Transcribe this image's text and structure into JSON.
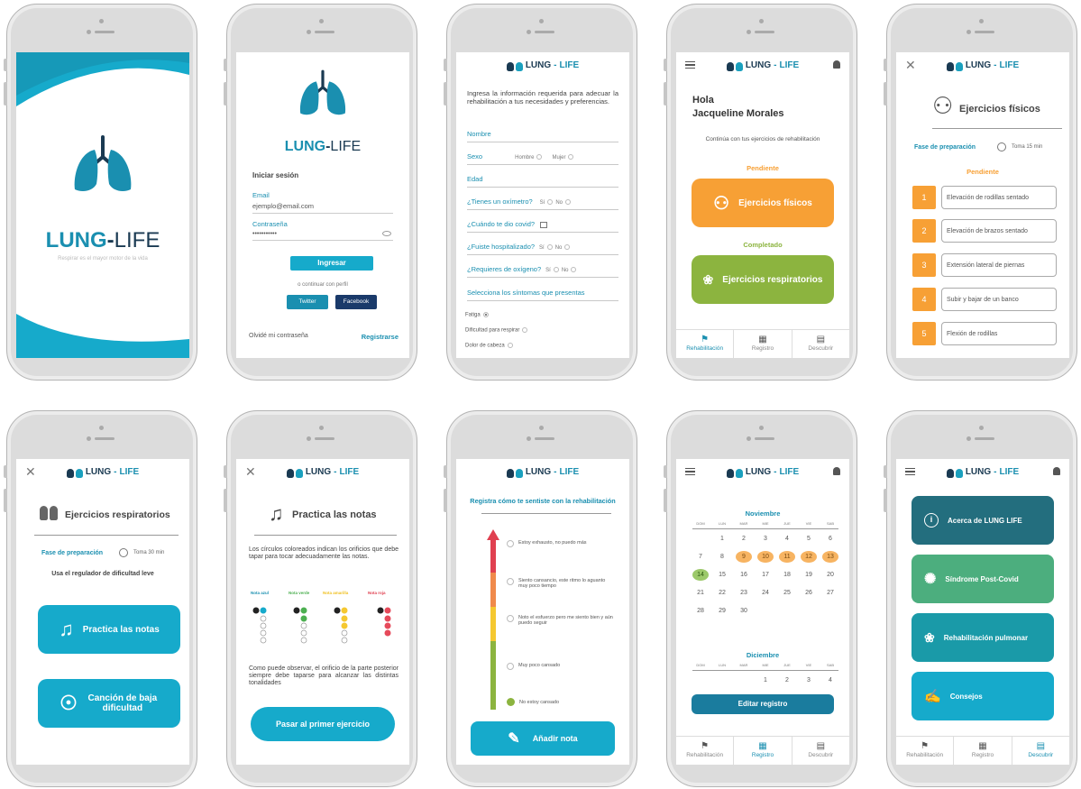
{
  "brand": {
    "lung": "LUNG",
    "life": "LIFE",
    "dash": "-",
    "tagline": "Respirar es el mayor motor de la vida"
  },
  "login": {
    "title": "Iniciar sesión",
    "email_label": "Email",
    "email_value": "ejemplo@email.com",
    "password_label": "Contraseña",
    "password_value": "•••••••••••",
    "submit": "Ingresar",
    "alt_text": "o continuar con perfil",
    "twitter": "Twitter",
    "facebook": "Facebook",
    "forgot": "Olvidé mi contraseña",
    "register": "Registrarse"
  },
  "form": {
    "intro": "Ingresa la información requerida para adecuar la rehabilitación a tus necesidades y preferencias.",
    "nombre": "Nombre",
    "sexo": "Sexo",
    "hombre": "Hombre",
    "mujer": "Mujer",
    "edad": "Edad",
    "oximetro": "¿Tienes un oxímetro?",
    "covid": "¿Cuándo te dio covid?",
    "hospital": "¿Fuiste hospitalizado?",
    "oxigeno": "¿Requieres de oxígeno?",
    "si": "Sí",
    "no": "No",
    "sintomas": "Selecciona los síntomas que presentas",
    "fatiga": "Fatiga",
    "dificultad": "Dificultad para respirar",
    "dolor": "Dolor de cabeza"
  },
  "home": {
    "hola": "Hola",
    "name": "Jacqueline Morales",
    "continue": "Continúa con tus ejercicios de rehabilitación",
    "pendiente": "Pendiente",
    "fisicos": "Ejercicios físicos",
    "completado": "Completado",
    "respiratorios": "Ejercicios respiratorios"
  },
  "nav": {
    "rehab": "Rehabilitación",
    "registro": "Registro",
    "descubrir": "Descubrir"
  },
  "fisicos": {
    "title": "Ejercicios físicos",
    "phase": "Fase de preparación",
    "time": "Toma 15 min",
    "pendiente": "Pendiente",
    "items": [
      {
        "n": "1",
        "t": "Elevación de rodillas sentado"
      },
      {
        "n": "2",
        "t": "Elevación de brazos sentado"
      },
      {
        "n": "3",
        "t": "Extensión lateral de piernas"
      },
      {
        "n": "4",
        "t": "Subir y bajar de un banco"
      },
      {
        "n": "5",
        "t": "Flexión de rodillas"
      }
    ]
  },
  "respiratorios": {
    "title": "Ejercicios respiratorios",
    "phase": "Fase de preparación",
    "time": "Toma 30 min",
    "hint": "Usa el regulador de dificultad leve",
    "practica": "Practica las notas",
    "cancion": "Canción de baja dificultad"
  },
  "notas": {
    "title": "Practica las notas",
    "intro": "Los círculos coloreados indican los orificios que debe tapar para tocar adecuadamente las notas.",
    "azul": "Nota azul",
    "verde": "Nota verde",
    "amarilla": "Nota amarilla",
    "roja": "Nota roja",
    "outro": "Como puede observar, el orificio de la parte posterior siempre debe taparse para alcanzar las distintas tonalidades",
    "cta": "Pasar al primer ejercicio"
  },
  "registro": {
    "title": "Registra cómo te sentiste con la rehabilitación",
    "levels": [
      "Estoy exhausto, no puedo más",
      "Siento cansancio, este ritmo lo aguanto muy poco tiempo",
      "Noto el esfuerzo pero me siento bien y aún puedo seguir",
      "Muy poco cansado",
      "No estoy cansado"
    ],
    "add": "Añadir nota"
  },
  "calendar": {
    "month1": "Noviembre",
    "month2": "Diciembre",
    "days": [
      "DOM",
      "LUN",
      "MAR",
      "MIE",
      "JUE",
      "VIE",
      "SAB"
    ],
    "edit": "Editar registro",
    "weeks": [
      [
        "",
        "1",
        "2",
        "3",
        "4",
        "5",
        "6"
      ],
      [
        "7",
        "8",
        "9",
        "10",
        "11",
        "12",
        "13"
      ],
      [
        "14",
        "15",
        "16",
        "17",
        "18",
        "19",
        "20"
      ],
      [
        "21",
        "22",
        "23",
        "24",
        "25",
        "26",
        "27"
      ],
      [
        "28",
        "29",
        "30",
        "",
        "",
        "",
        ""
      ]
    ],
    "dec": [
      "",
      "",
      "",
      "1",
      "2",
      "3",
      "4"
    ]
  },
  "discover": {
    "acerca": "Acerca de LUNG LIFE",
    "sindrome": "Síndrome Post-Covid",
    "rehab": "Rehabilitación pulmonar",
    "consejos": "Consejos"
  },
  "colors": {
    "teal": "#16aacb",
    "navy": "#1a3a52",
    "orange": "#f7a035",
    "green": "#8cb43f"
  }
}
